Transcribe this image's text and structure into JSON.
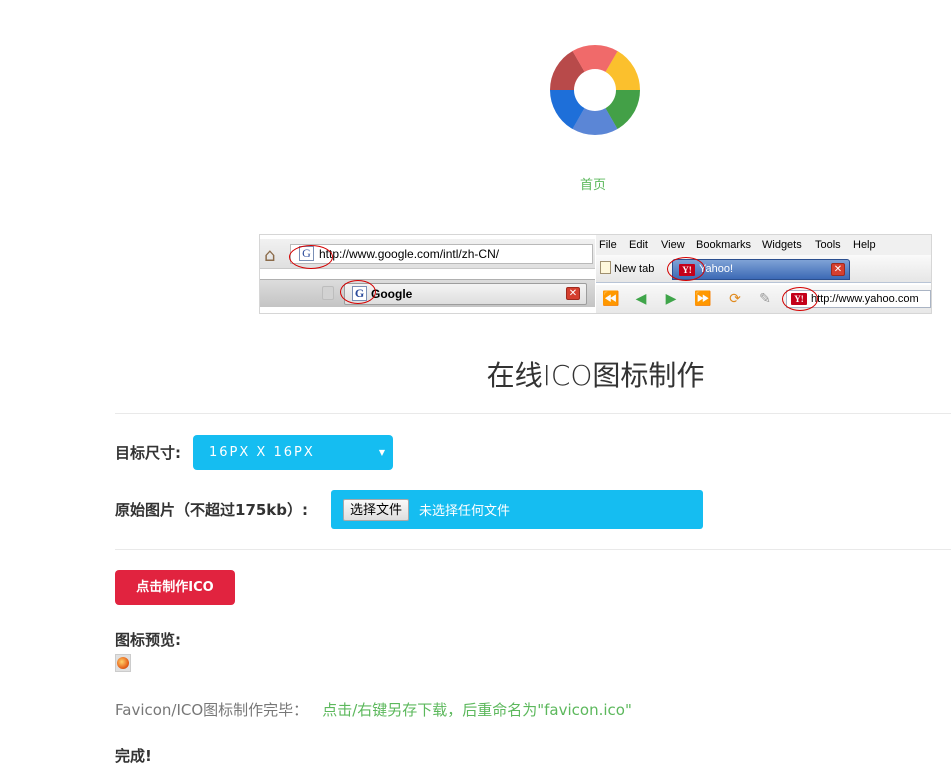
{
  "nav": {
    "home_link": "首页"
  },
  "example": {
    "firefox": {
      "url": "http://www.google.com/intl/zh-CN/",
      "tab_title": "Google",
      "favicon_letter": "G"
    },
    "opera": {
      "menu": [
        "File",
        "Edit",
        "View",
        "Bookmarks",
        "Widgets",
        "Tools",
        "Help"
      ],
      "new_tab": "New tab",
      "active_tab": "Yahoo!",
      "url": "http://www.yahoo.com",
      "favicon_letter": "Y!"
    }
  },
  "page": {
    "title": "在线ICO图标制作",
    "size_label": "目标尺寸:",
    "size_selected": "16PX X 16PX",
    "image_label": "原始图片（不超过175kb）:",
    "file_button": "选择文件",
    "file_status": "未选择任何文件",
    "make_button": "点击制作ICO",
    "preview_label": "图标预览:",
    "result_prefix": "Favicon/ICO图标制作完毕：",
    "download_text": "点击/右键另存下载，后重命名为\"favicon.ico\"",
    "done": "完成!"
  },
  "colors": {
    "accent": "#15bdf1",
    "danger": "#e1233f",
    "link": "#5cb85c"
  },
  "icons": {
    "logo": "color-wheel-logo",
    "home": "home-icon",
    "close": "close-icon",
    "back": "back-icon",
    "forward": "forward-icon",
    "reload": "reload-icon"
  }
}
